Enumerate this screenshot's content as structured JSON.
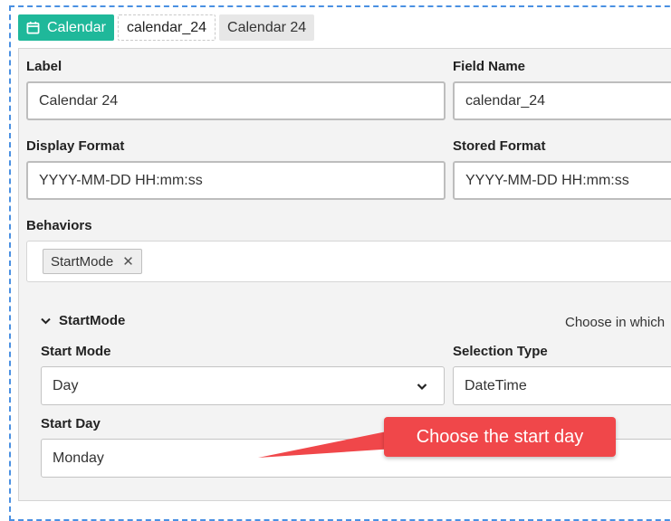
{
  "tags": {
    "type": "Calendar",
    "name": "calendar_24",
    "label": "Calendar 24"
  },
  "fields": {
    "label": {
      "title": "Label",
      "value": "Calendar 24"
    },
    "field_name": {
      "title": "Field Name",
      "value": "calendar_24"
    },
    "display_format": {
      "title": "Display Format",
      "value": "YYYY-MM-DD HH:mm:ss"
    },
    "stored_format": {
      "title": "Stored Format",
      "value": "YYYY-MM-DD HH:mm:ss"
    }
  },
  "behaviors": {
    "title": "Behaviors",
    "chips": [
      "StartMode"
    ]
  },
  "start_mode_section": {
    "title": "StartMode",
    "hint": "Choose in which",
    "start_mode": {
      "title": "Start Mode",
      "value": "Day"
    },
    "selection_type": {
      "title": "Selection Type",
      "value": "DateTime"
    },
    "start_day": {
      "title": "Start Day",
      "value": "Monday"
    }
  },
  "callout": {
    "text": "Choose the start day"
  },
  "colors": {
    "accent": "#1fb89a",
    "callout": "#f0474a",
    "frame": "#4a90e2"
  },
  "icons": {
    "type_tag": "calendar-icon",
    "chip_remove": "close-icon",
    "section_toggle": "chevron-down-icon",
    "dropdown": "chevron-down-icon"
  }
}
